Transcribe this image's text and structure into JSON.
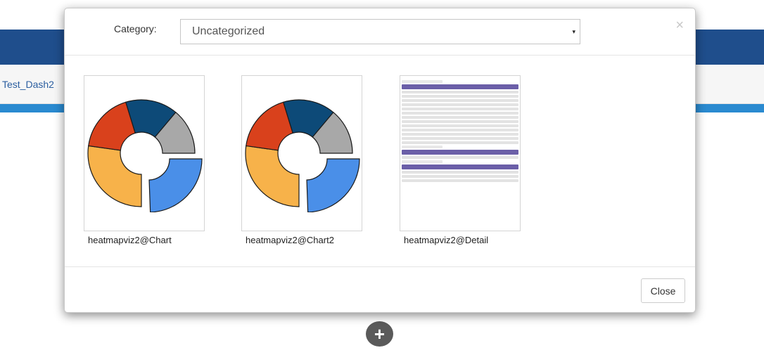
{
  "background": {
    "tab_label": "Test_Dash2",
    "add_icon": "plus-icon",
    "add_glyph": "+"
  },
  "modal": {
    "category": {
      "label": "Category:",
      "selected": "Uncategorized",
      "arrow_glyph": "▾"
    },
    "close_glyph": "×",
    "tiles": [
      {
        "label": "heatmapviz2@Chart",
        "thumbnail": "donut-chart-icon"
      },
      {
        "label": "heatmapviz2@Chart2",
        "thumbnail": "donut-chart-icon"
      },
      {
        "label": "heatmapviz2@Detail",
        "thumbnail": "table-preview"
      }
    ],
    "footer": {
      "close_label": "Close"
    }
  },
  "colors": {
    "header_blue": "#1f4e8c",
    "strip_blue": "#2a8ad0",
    "donut_red": "#d9411c",
    "donut_navy": "#0d4a78",
    "donut_gray": "#a8a8a8",
    "donut_blue": "#4a8fe8",
    "donut_orange": "#f7b24a",
    "table_header": "#6b5fa8"
  }
}
